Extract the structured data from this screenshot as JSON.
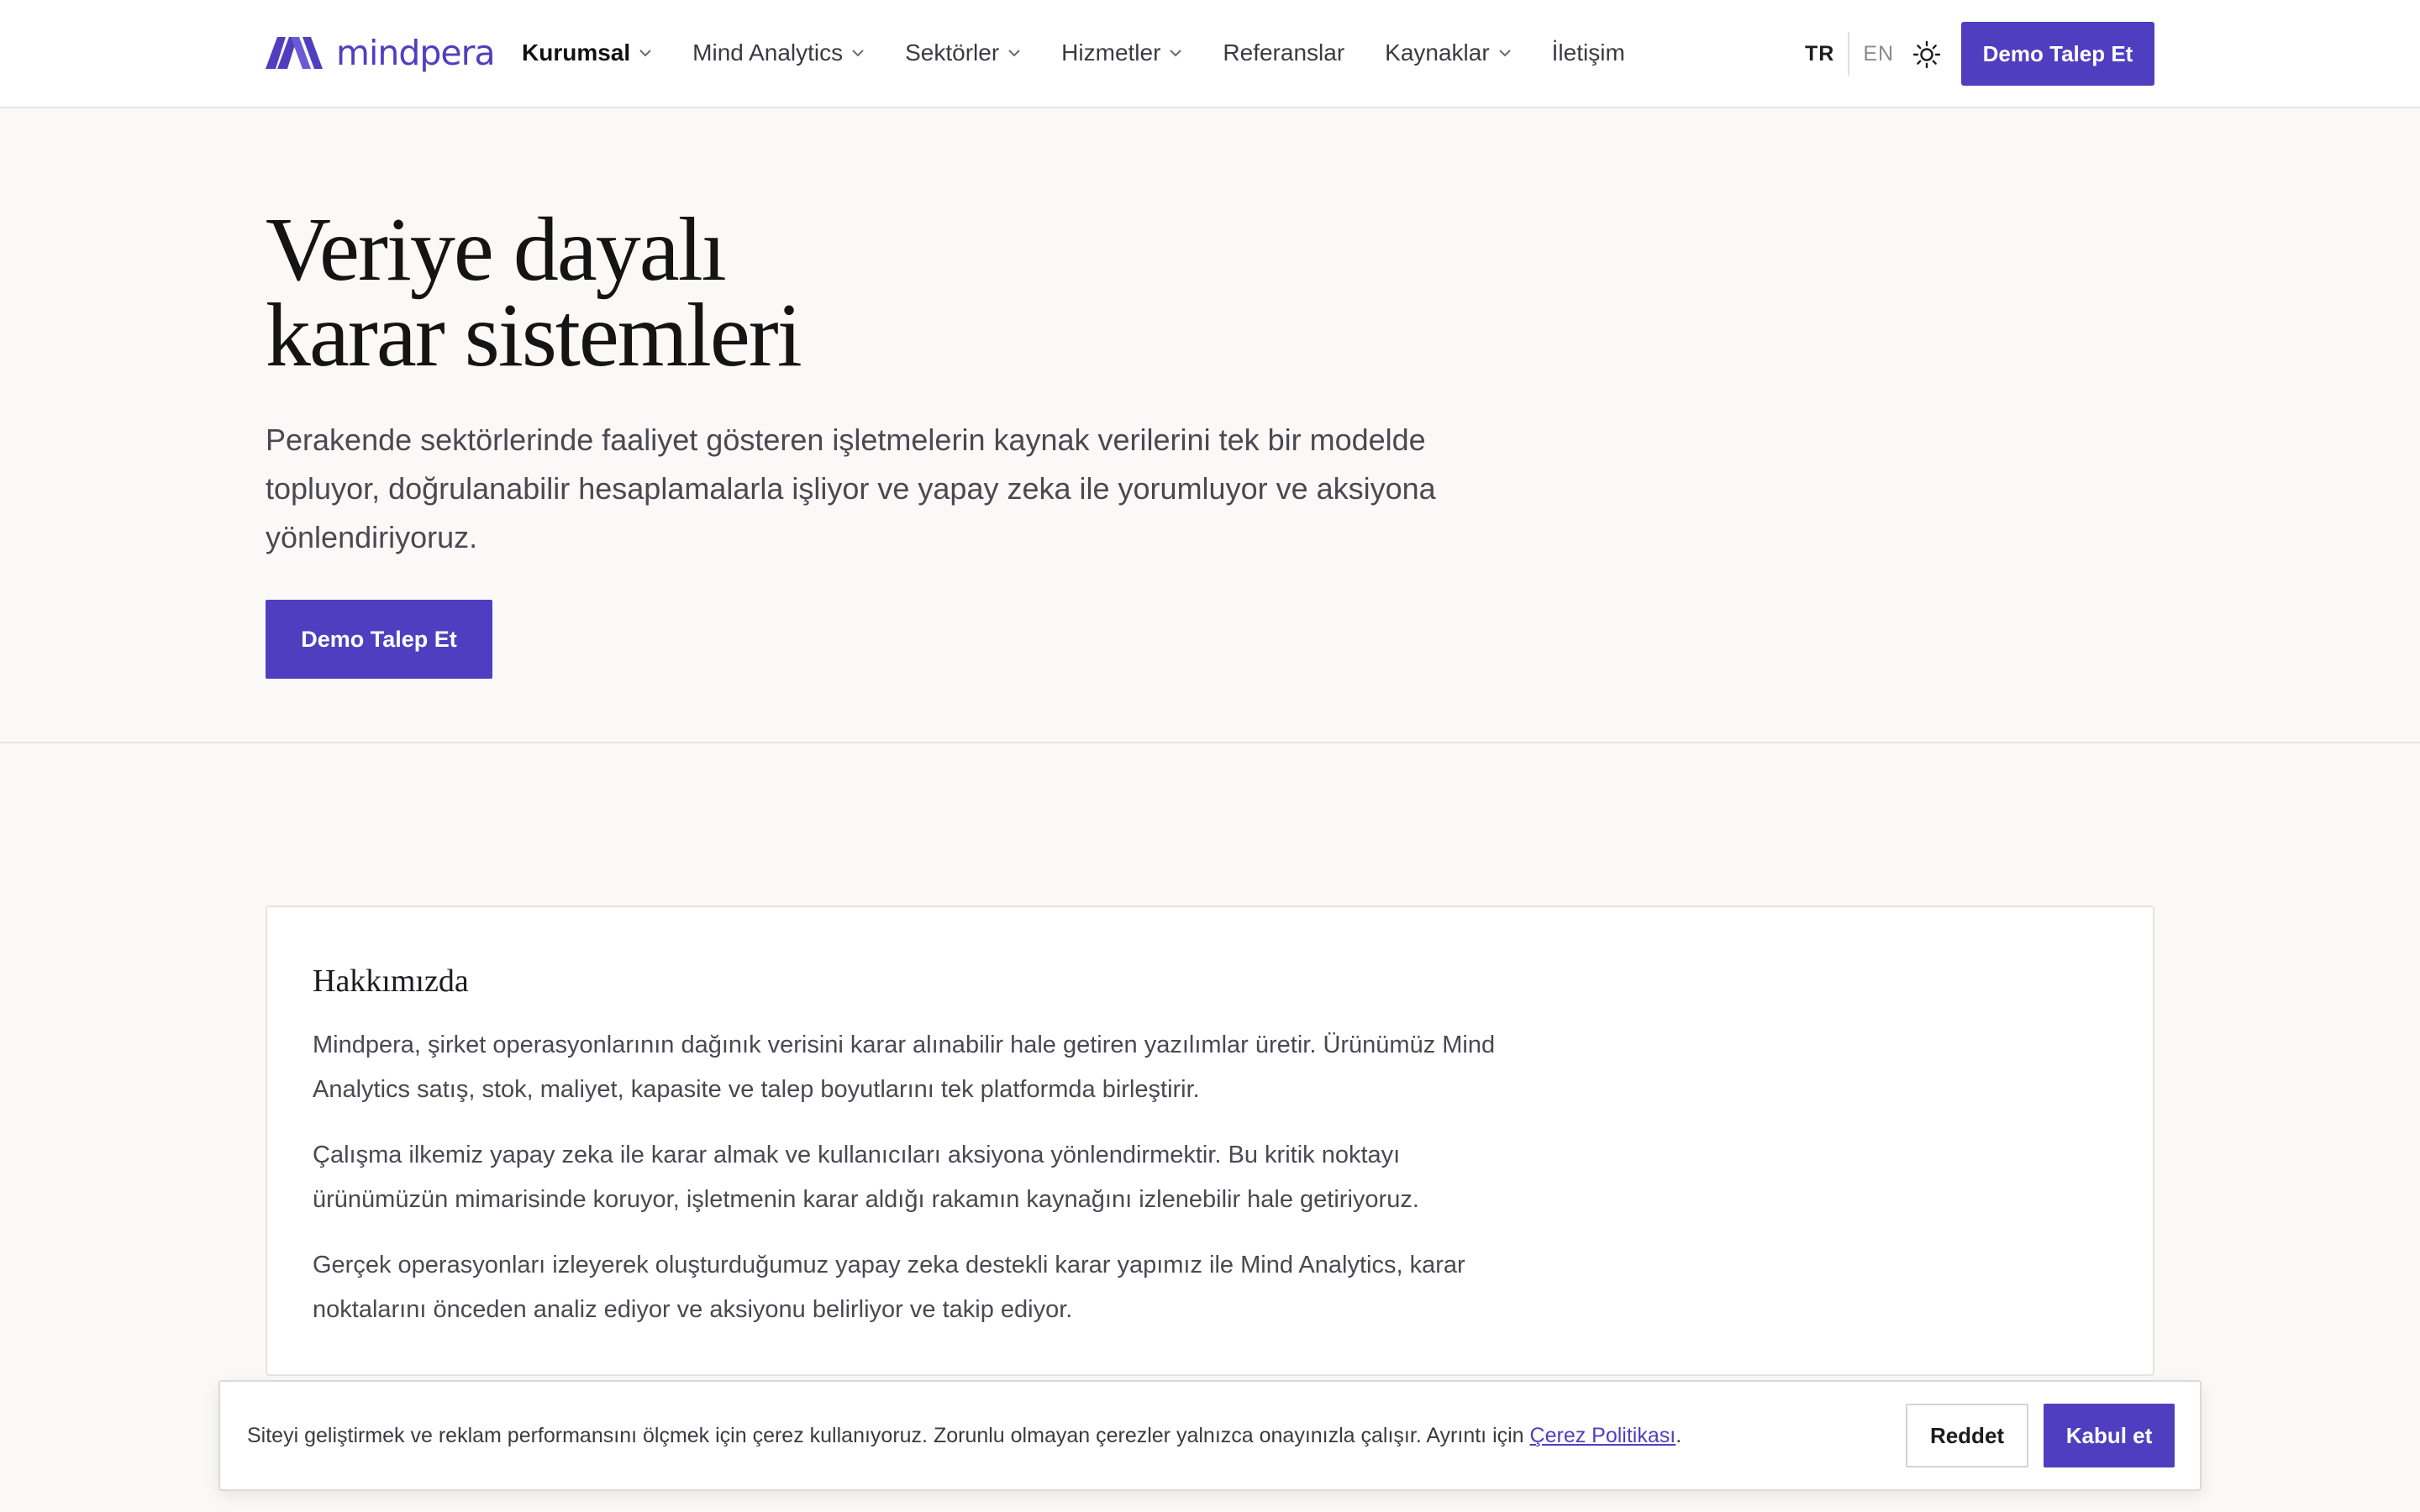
{
  "brand": {
    "name": "mindpera",
    "color": "#4f3fc0"
  },
  "nav": {
    "items": [
      {
        "label": "Kurumsal",
        "dropdown": true,
        "active": true
      },
      {
        "label": "Mind Analytics",
        "dropdown": true
      },
      {
        "label": "Sektörler",
        "dropdown": true
      },
      {
        "label": "Hizmetler",
        "dropdown": true
      },
      {
        "label": "Referanslar",
        "dropdown": false
      },
      {
        "label": "Kaynaklar",
        "dropdown": true
      },
      {
        "label": "İletişim",
        "dropdown": false
      }
    ],
    "lang_tr": "TR",
    "lang_en": "EN",
    "theme_icon": "sun-icon",
    "cta": "Demo Talep Et"
  },
  "hero": {
    "title_line1": "Veriye dayalı",
    "title_line2": "karar sistemleri",
    "description": "Perakende sektörlerinde faaliyet gösteren işletmelerin kaynak verilerini tek bir modelde topluyor, doğrulanabilir hesaplamalarla işliyor ve yapay zeka ile yorumluyor ve aksiyona yönlendiriyoruz.",
    "cta": "Demo Talep Et"
  },
  "about": {
    "title": "Hakkımızda",
    "p1": "Mindpera, şirket operasyonlarının dağınık verisini karar alınabilir hale getiren yazılımlar üretir. Ürünümüz Mind Analytics satış, stok, maliyet, kapasite ve talep boyutlarını tek platformda birleştirir.",
    "p2": "Çalışma ilkemiz yapay zeka ile karar almak ve kullanıcıları aksiyona yönlendirmektir. Bu kritik noktayı ürünümüzün mimarisinde koruyor, işletmenin karar aldığı rakamın kaynağını izlenebilir hale getiriyoruz.",
    "p3": "Gerçek operasyonları izleyerek oluşturduğumuz yapay zeka destekli karar yapımız ile Mind Analytics, karar noktalarını önceden analiz ediyor ve aksiyonu belirliyor ve takip ediyor."
  },
  "cookie": {
    "text": "Siteyi geliştirmek ve reklam performansını ölçmek için çerez kullanıyoruz. Zorunlu olmayan çerezler yalnızca onayınızla çalışır. Ayrıntı için ",
    "link": "Çerez Politikası",
    "suffix": ".",
    "reject": "Reddet",
    "accept": "Kabul et"
  }
}
